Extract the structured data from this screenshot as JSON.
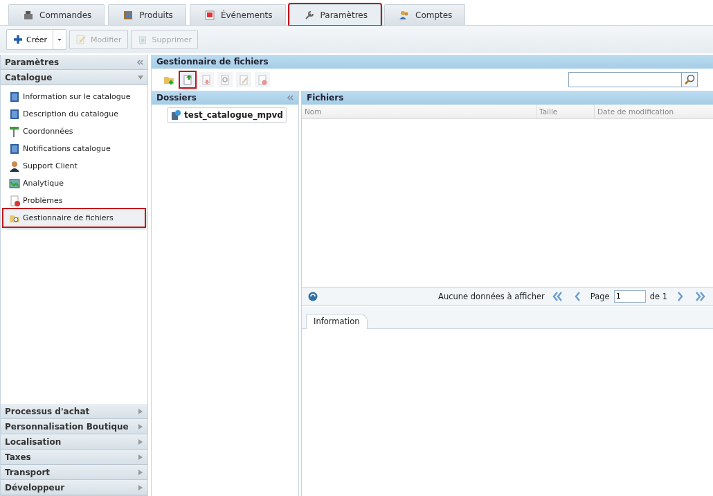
{
  "tabs": [
    {
      "label": "Commandes",
      "selected": false,
      "highlighted": false
    },
    {
      "label": "Produits",
      "selected": false,
      "highlighted": false
    },
    {
      "label": "Événements",
      "selected": false,
      "highlighted": false
    },
    {
      "label": "Paramètres",
      "selected": true,
      "highlighted": true
    },
    {
      "label": "Comptes",
      "selected": false,
      "highlighted": false
    }
  ],
  "toolbar": [
    {
      "label": "Créer",
      "disabled": false,
      "kind": "split"
    },
    {
      "label": "Modifier",
      "disabled": true,
      "kind": "plain"
    },
    {
      "label": "Supprimer",
      "disabled": true,
      "kind": "plain"
    }
  ],
  "sidebar": {
    "title": "Paramètres",
    "sections": [
      {
        "title": "Catalogue",
        "expanded": true,
        "items": [
          {
            "label": "Information sur le catalogue",
            "selected": false,
            "highlighted": false
          },
          {
            "label": "Description du catalogue",
            "selected": false,
            "highlighted": false
          },
          {
            "label": "Coordonnées",
            "selected": false,
            "highlighted": false
          },
          {
            "label": "Notifications catalogue",
            "selected": false,
            "highlighted": false
          },
          {
            "label": "Support Client",
            "selected": false,
            "highlighted": false
          },
          {
            "label": "Analytique",
            "selected": false,
            "highlighted": false
          },
          {
            "label": "Problèmes",
            "selected": false,
            "highlighted": false
          },
          {
            "label": "Gestionnaire de fichiers",
            "selected": true,
            "highlighted": true
          }
        ]
      },
      {
        "title": "Processus d'achat",
        "expanded": false
      },
      {
        "title": "Personnalisation Boutique",
        "expanded": false
      },
      {
        "title": "Localisation",
        "expanded": false
      },
      {
        "title": "Taxes",
        "expanded": false
      },
      {
        "title": "Transport",
        "expanded": false
      },
      {
        "title": "Développeur",
        "expanded": false
      }
    ]
  },
  "file_manager": {
    "title": "Gestionnaire de fichiers",
    "tools": [
      {
        "disabled": false,
        "highlighted": false
      },
      {
        "disabled": false,
        "highlighted": true
      },
      {
        "disabled": true,
        "highlighted": false
      },
      {
        "disabled": true,
        "highlighted": false
      },
      {
        "disabled": true,
        "highlighted": false
      },
      {
        "disabled": true,
        "highlighted": false
      }
    ],
    "folders": {
      "title": "Dossiers",
      "items": [
        {
          "label": "test_catalogue_mpvd"
        }
      ]
    },
    "files": {
      "title": "Fichiers",
      "columns": [
        "Nom",
        "Taille",
        "Date de modification"
      ]
    },
    "paging": {
      "message": "Aucune données à afficher",
      "page_label": "Page",
      "page_value": "1",
      "of_label": "de 1"
    },
    "detail_tabs": [
      {
        "label": "Information",
        "selected": true
      }
    ]
  }
}
